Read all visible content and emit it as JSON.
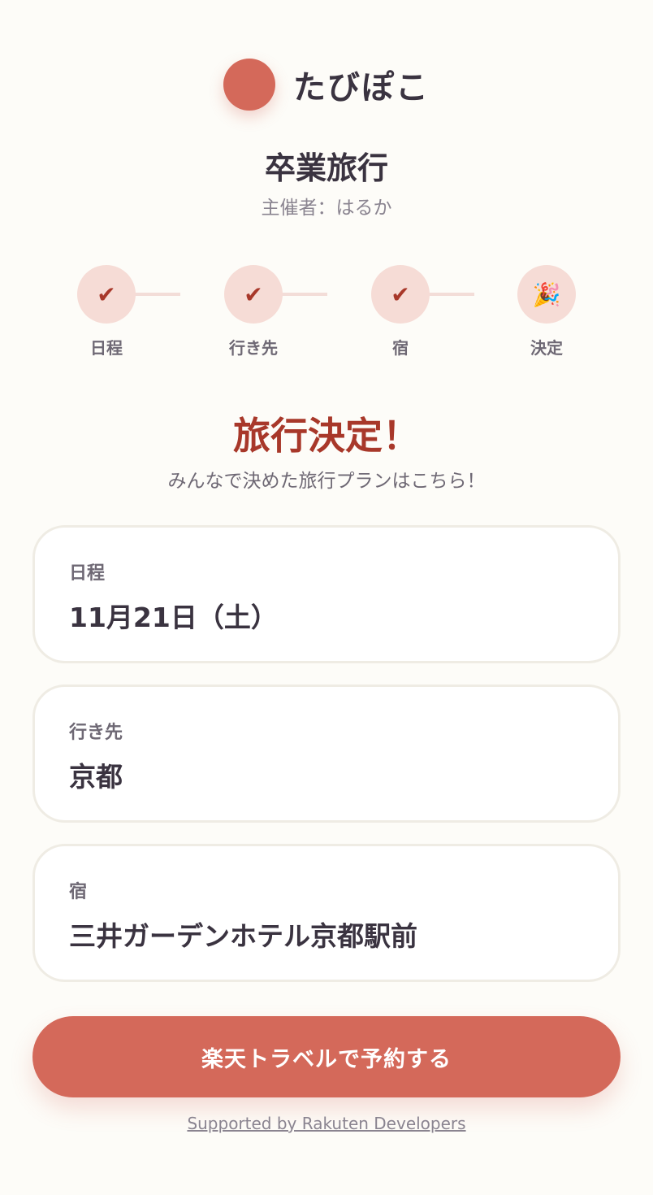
{
  "app": {
    "name": "たびぽこ"
  },
  "trip": {
    "title": "卒業旅行",
    "organizer": "主催者：はるか"
  },
  "steps": [
    {
      "label": "日程",
      "icon": "check-icon",
      "glyph": "✔"
    },
    {
      "label": "行き先",
      "icon": "check-icon",
      "glyph": "✔"
    },
    {
      "label": "宿",
      "icon": "check-icon",
      "glyph": "✔"
    },
    {
      "label": "決定",
      "icon": "party-popper-icon",
      "glyph": "🎉"
    }
  ],
  "decision": {
    "title": "旅行決定！",
    "subtitle": "みんなで決めた旅行プランはこちら！"
  },
  "cards": [
    {
      "label": "日程",
      "value": "11月21日（土）"
    },
    {
      "label": "行き先",
      "value": "京都"
    },
    {
      "label": "宿",
      "value": "三井ガーデンホテル京都駅前"
    }
  ],
  "actions": {
    "book_label": "楽天トラベルで予約する"
  },
  "footer": {
    "support_text": "Supported by Rakuten Developers"
  },
  "colors": {
    "accent": "#d4695a",
    "accent_dark": "#a8382a",
    "step_bg": "#f6dcd6",
    "background": "#fdfcf8"
  }
}
